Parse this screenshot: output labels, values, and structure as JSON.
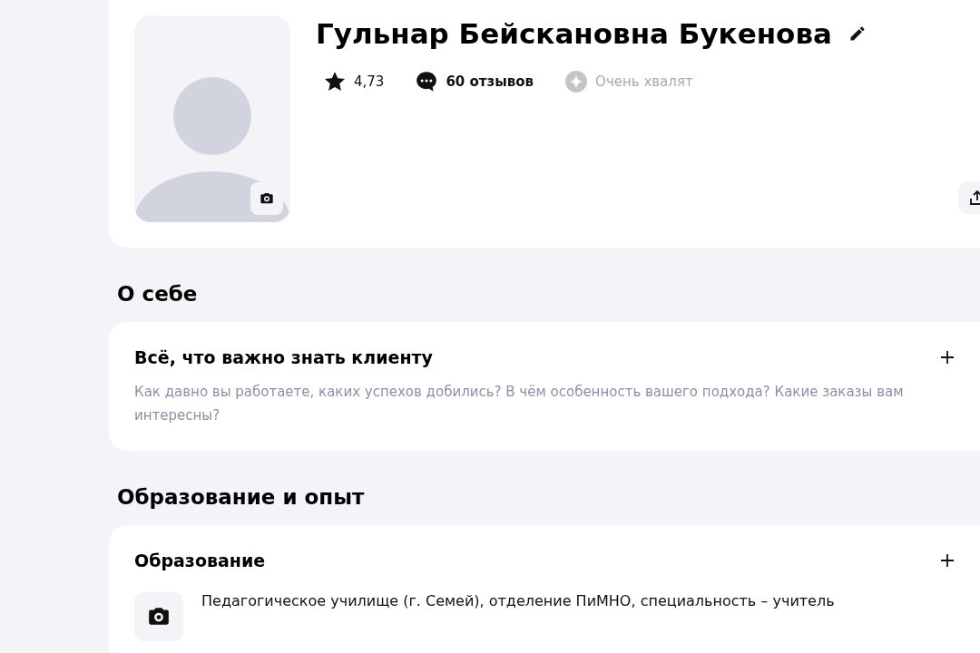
{
  "profile": {
    "name": "Гульнар Бейскановна Букенова",
    "rating": "4,73",
    "reviews": "60 отзывов",
    "badge": {
      "label": "Очень хвалят",
      "earned": false
    }
  },
  "sections": [
    {
      "title": "О себе",
      "cards": [
        {
          "title": "Всё, что важно знать клиенту",
          "prompt": "Как давно вы работаете, каких успехов добились? В чём особенность вашего подхода? Какие заказы вам интересны?"
        }
      ]
    },
    {
      "title": "Образование и опыт",
      "cards": [
        {
          "title": "Образование",
          "items": [
            "Педагогическое училище (г. Семей), отделение ПиМНО, специальность – учитель"
          ]
        }
      ]
    }
  ]
}
